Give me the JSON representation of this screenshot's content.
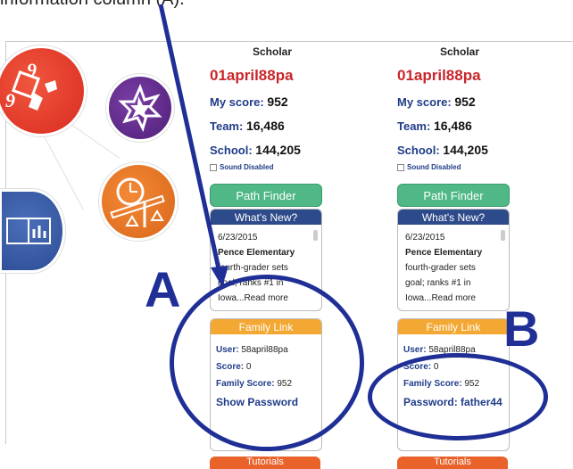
{
  "caption": "information column (A).",
  "panels": [
    {
      "scholar": "Scholar",
      "username": "01april88pa",
      "my_score_label": "My score:",
      "my_score": "952",
      "team_label": "Team:",
      "team": "16,486",
      "school_label": "School:",
      "school": "144,205",
      "sound": "Sound Disabled",
      "path_finder": "Path Finder",
      "whats_new": "What's New?",
      "news_date": "6/23/2015",
      "news_title": "Pence Elementary",
      "news_line1": "fourth-grader sets",
      "news_line2": "goal; ranks #1 in",
      "news_line3": "Iowa...Read more",
      "family_link": "Family Link",
      "user_label": "User:",
      "user": "58april88pa",
      "score_label": "Score:",
      "score": "0",
      "family_score_label": "Family Score:",
      "family_score": "952",
      "credential": "Show Password",
      "tutorials": "Tutorials"
    },
    {
      "scholar": "Scholar",
      "username": "01april88pa",
      "my_score_label": "My score:",
      "my_score": "952",
      "team_label": "Team:",
      "team": "16,486",
      "school_label": "School:",
      "school": "144,205",
      "sound": "Sound Disabled",
      "path_finder": "Path Finder",
      "whats_new": "What's New?",
      "news_date": "6/23/2015",
      "news_title": "Pence Elementary",
      "news_line1": "fourth-grader sets",
      "news_line2": "goal; ranks #1 in",
      "news_line3": "Iowa...Read more",
      "family_link": "Family Link",
      "user_label": "User:",
      "user": "58april88pa",
      "score_label": "Score:",
      "score": "0",
      "family_score_label": "Family Score:",
      "family_score": "952",
      "credential": "Password: father44",
      "tutorials": "Tutorials"
    }
  ],
  "labels": {
    "a": "A",
    "b": "B"
  },
  "colors": {
    "annotation": "#1f2f96",
    "username": "#c8262b",
    "path_finder": "#4fb886",
    "news_header": "#2d4a8a",
    "family_header": "#f2a833",
    "tutorials": "#e8622a"
  }
}
